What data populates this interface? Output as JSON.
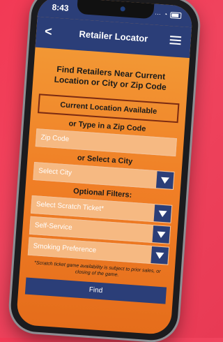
{
  "status": {
    "time": "8:43",
    "signal": "···",
    "wifi": "◔"
  },
  "nav": {
    "back": "<",
    "title": "Retailer Locator"
  },
  "form": {
    "heading": "Find Retailers Near Current Location or City or Zip Code",
    "current_location": "Current Location Available",
    "zip_prompt": "or Type in a Zip Code",
    "zip_placeholder": "Zip Code",
    "city_prompt": "or Select a City",
    "city_select": "Select City",
    "optional_title": "Optional Filters:",
    "filters": [
      "Select Scratch Ticket*",
      "Self-Service",
      "Smoking Preference"
    ],
    "note": "*Scratch ticket game availability is subject to prior sales, or closing of the game.",
    "find": "Find"
  },
  "colors": {
    "navy": "#2b3e78",
    "orange": "#f07f26",
    "background": "#f23a55"
  }
}
